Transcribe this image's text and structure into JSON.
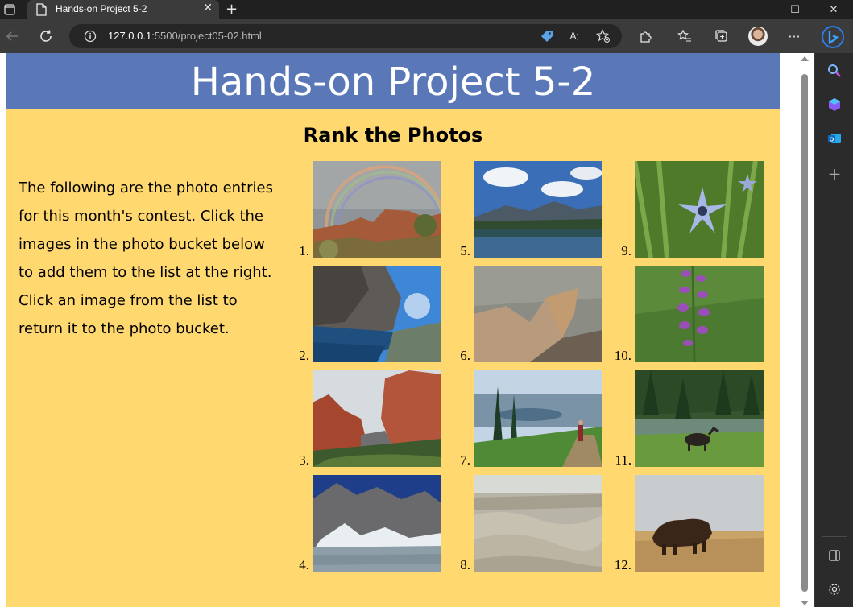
{
  "browser": {
    "tab_title": "Hands-on Project 5-2",
    "url_host": "127.0.0.1",
    "url_rest": ":5500/project05-02.html"
  },
  "page": {
    "heading": "Hands-on Project 5-2",
    "subheading": "Rank the Photos",
    "intro": "The following are the photo entries for this month's contest. Click the images in the photo bucket below to add them to the list at the right. Click an image from the list to return it to the photo bucket."
  },
  "photos": [
    {
      "num": "1.",
      "icon": "rainbow-canyon-photo"
    },
    {
      "num": "2.",
      "icon": "mountain-lake-photo"
    },
    {
      "num": "3.",
      "icon": "red-rocks-photo"
    },
    {
      "num": "4.",
      "icon": "snowy-mountain-lake-photo"
    },
    {
      "num": "5.",
      "icon": "alpine-lake-reflection-photo"
    },
    {
      "num": "6.",
      "icon": "rock-cliff-photo"
    },
    {
      "num": "7.",
      "icon": "hiker-trail-photo"
    },
    {
      "num": "8.",
      "icon": "badlands-photo"
    },
    {
      "num": "9.",
      "icon": "blue-star-flower-photo"
    },
    {
      "num": "10.",
      "icon": "purple-flower-photo"
    },
    {
      "num": "11.",
      "icon": "moose-meadow-photo"
    },
    {
      "num": "12.",
      "icon": "bison-prairie-photo"
    }
  ],
  "colors": {
    "header_bg": "#5a78b8",
    "page_bg": "#ffd86f"
  }
}
